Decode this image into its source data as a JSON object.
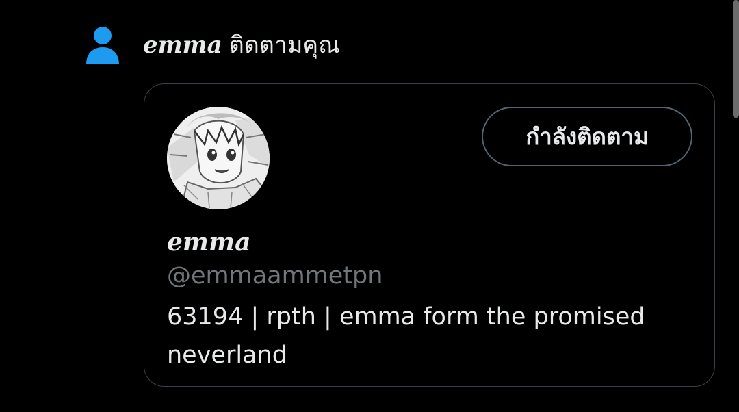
{
  "notification": {
    "icon": "person-icon",
    "name": "emma",
    "action_text": "ติดตามคุณ"
  },
  "profile_card": {
    "avatar": "profile-avatar",
    "display_name": "emma",
    "handle": "@emmaammetpn",
    "bio": "63194 | rpth | emma form the promised neverland",
    "follow_button_label": "กำลังติดตาม"
  },
  "colors": {
    "background": "#000000",
    "primary_text": "#e7e9ea",
    "secondary_text": "#71767b",
    "accent_blue": "#1d9bf0",
    "card_border": "#3a4047",
    "button_border": "#536471"
  }
}
